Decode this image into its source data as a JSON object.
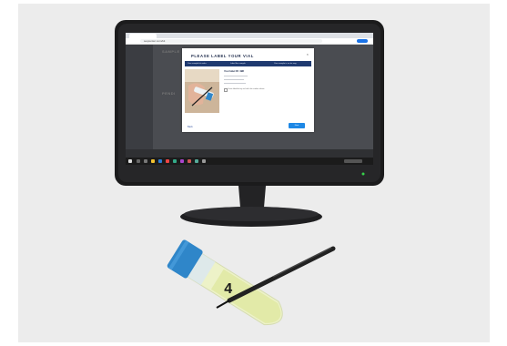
{
  "modal": {
    "title": "PLEASE LABEL YOUR VIAL",
    "close": "×",
    "steps": [
      "Your sample kit order",
      "Label the sample",
      "Your sample is on its way"
    ],
    "body_heading": "Your label ID: 4B6",
    "checkbox_text": "I have labelled my vial with the number above",
    "back_label": "Back",
    "next_label": "Next"
  },
  "background_page": {
    "title": "SAMPLE",
    "section_title": "PENDI"
  },
  "browser": {
    "address": "seqcenter.com/kit"
  },
  "vial": {
    "label": "4"
  },
  "colors": {
    "modal_header": "#1f3a70",
    "primary_button": "#1e88e5",
    "vial_cap": "#2f86c9",
    "vial_liquid": "#dfe7a0"
  }
}
